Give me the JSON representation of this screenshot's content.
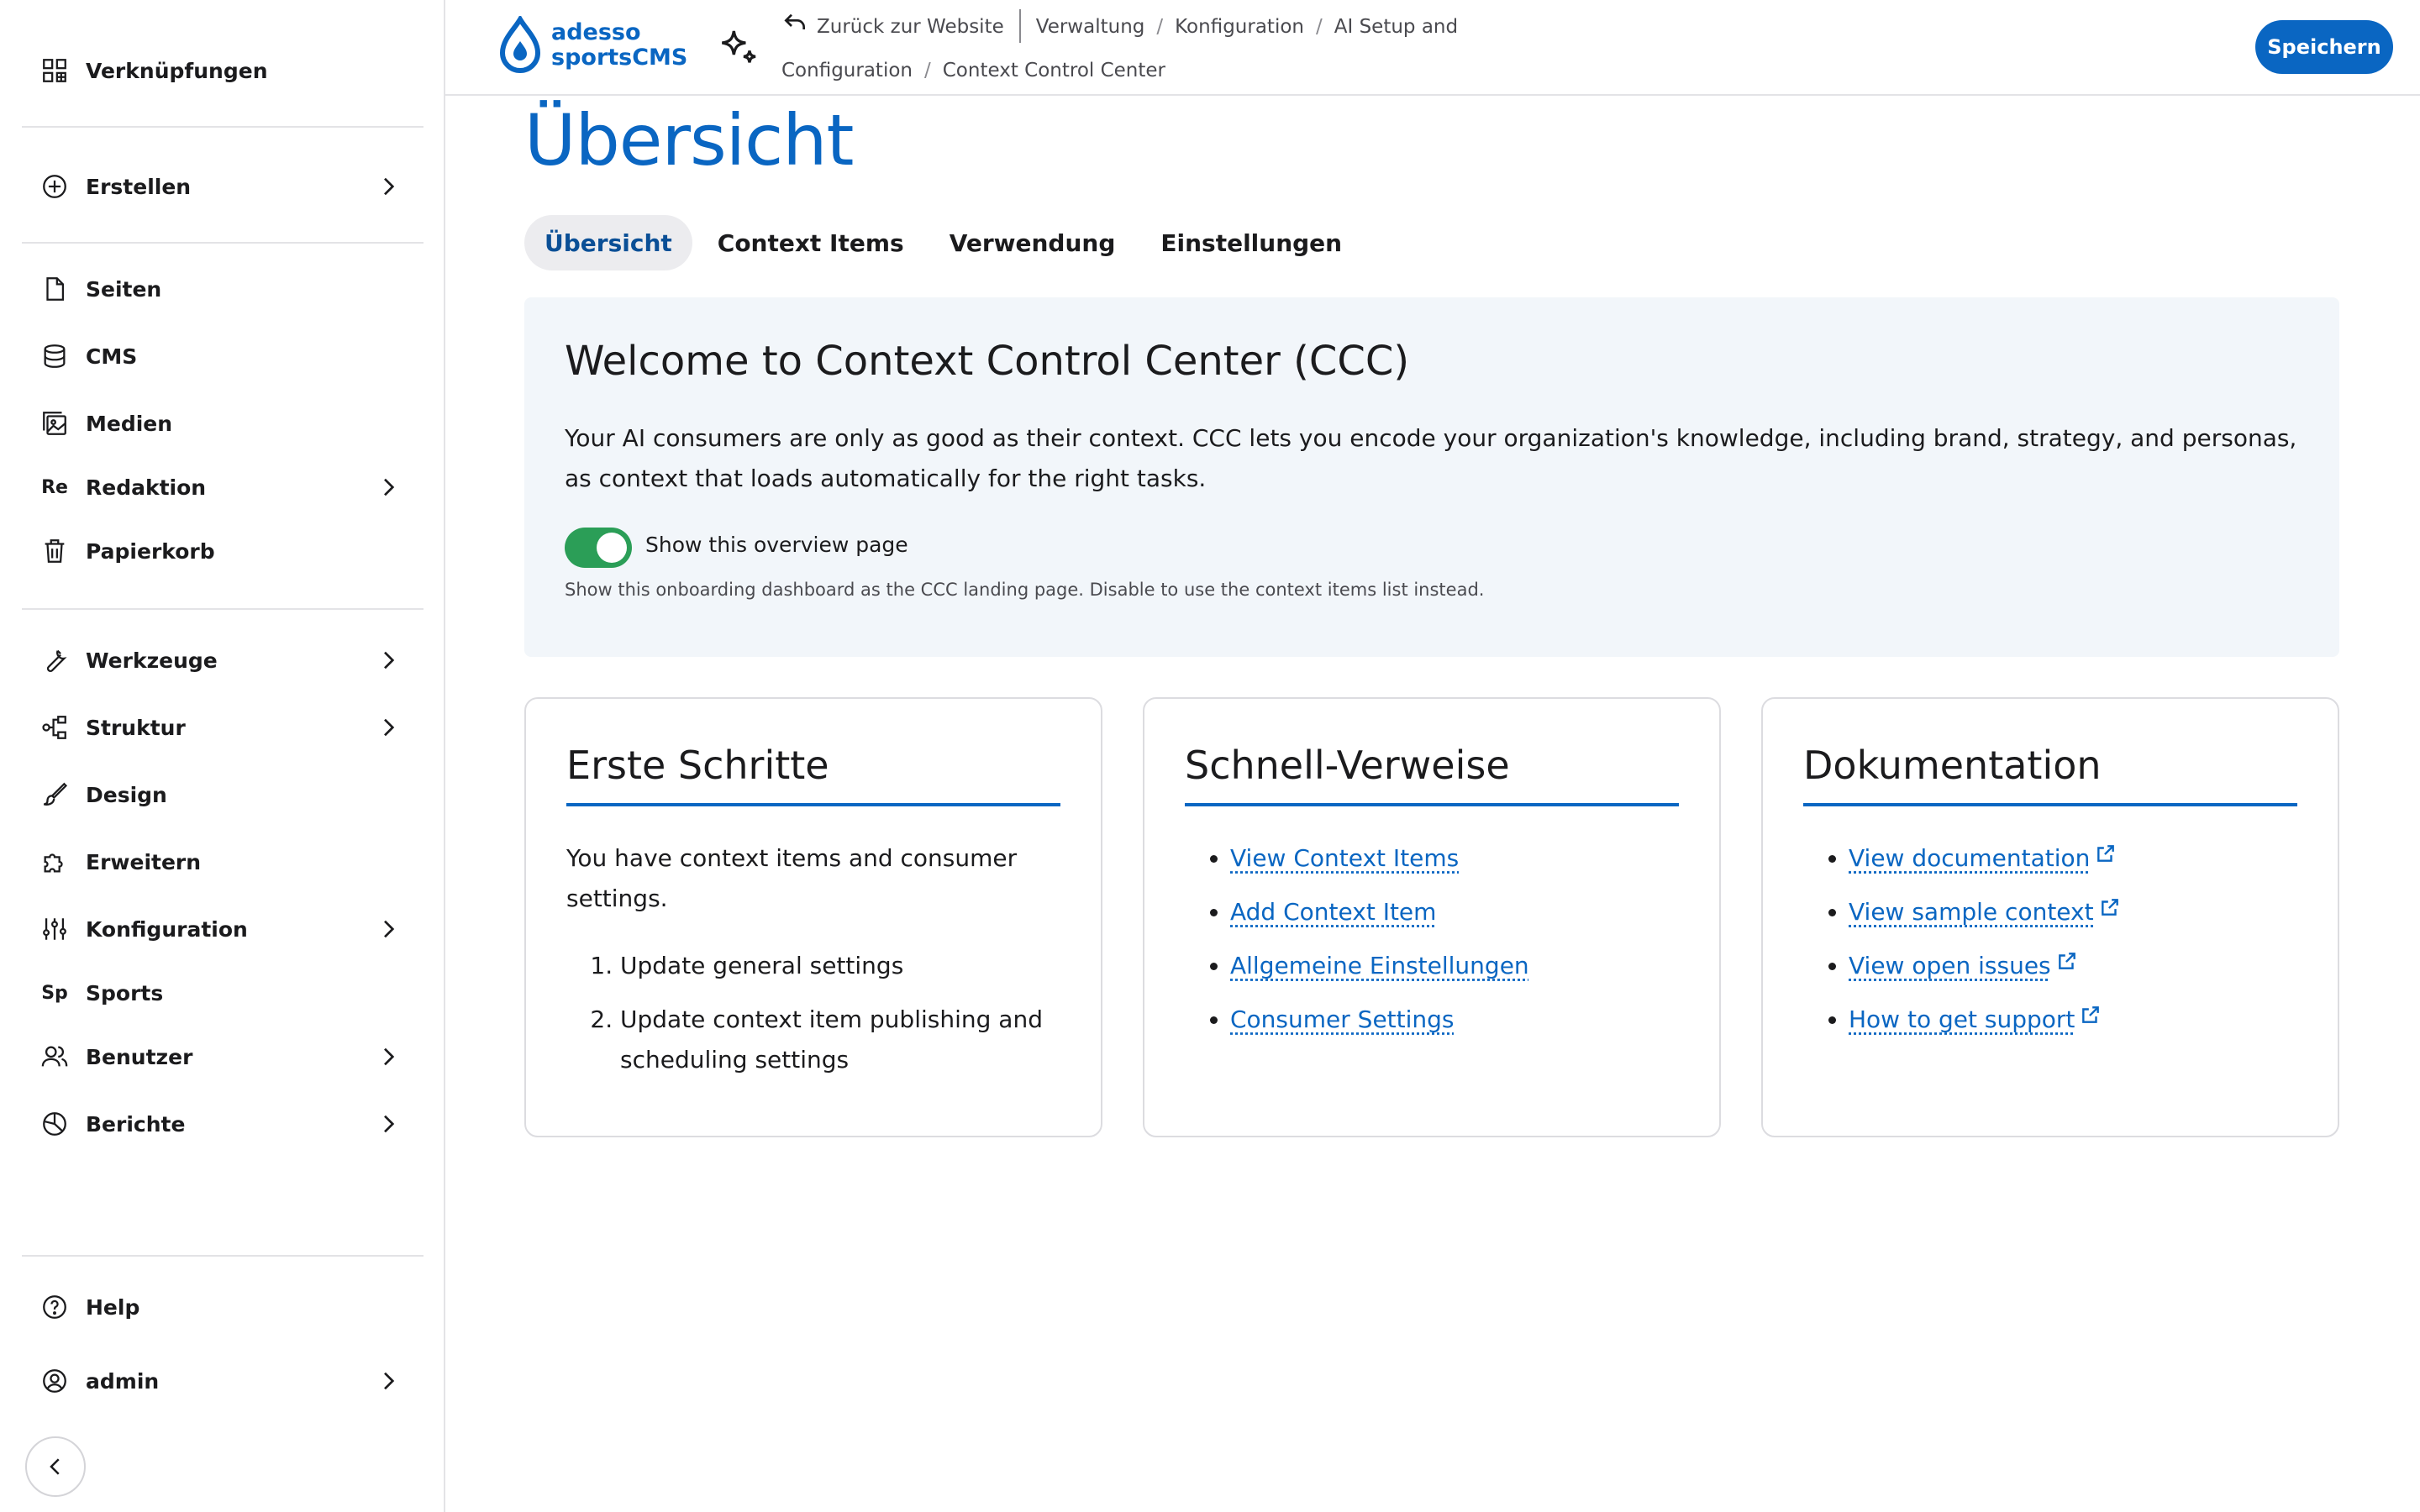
{
  "sidebar": {
    "items": [
      {
        "label": "Verknüpfungen",
        "icon": "shortcuts-icon",
        "expandable": false
      },
      {
        "label": "Erstellen",
        "icon": "plus-circle-icon",
        "expandable": true
      },
      {
        "label": "Seiten",
        "icon": "page-icon",
        "expandable": false
      },
      {
        "label": "CMS",
        "icon": "database-icon",
        "expandable": false
      },
      {
        "label": "Medien",
        "icon": "media-icon",
        "expandable": false
      },
      {
        "label": "Redaktion",
        "abbr": "Re",
        "expandable": true
      },
      {
        "label": "Papierkorb",
        "icon": "trash-icon",
        "expandable": false
      },
      {
        "label": "Werkzeuge",
        "icon": "wrench-icon",
        "expandable": true
      },
      {
        "label": "Struktur",
        "icon": "structure-icon",
        "expandable": true
      },
      {
        "label": "Design",
        "icon": "brush-icon",
        "expandable": false
      },
      {
        "label": "Erweitern",
        "icon": "puzzle-icon",
        "expandable": false
      },
      {
        "label": "Konfiguration",
        "icon": "sliders-icon",
        "expandable": true
      },
      {
        "label": "Sports",
        "abbr": "Sp",
        "expandable": false
      },
      {
        "label": "Benutzer",
        "icon": "users-icon",
        "expandable": true
      },
      {
        "label": "Berichte",
        "icon": "chart-icon",
        "expandable": true
      }
    ],
    "help": "Help",
    "user": "admin"
  },
  "topbar": {
    "logo_line1": "adesso",
    "logo_line2": "sportsCMS",
    "back_link": "Zurück zur Website",
    "crumbs": [
      "Verwaltung",
      "Konfiguration",
      "AI Setup and Configuration",
      "Context Control Center"
    ],
    "save_label": "Speichern"
  },
  "main": {
    "title": "Übersicht",
    "tabs": [
      "Übersicht",
      "Context Items",
      "Verwendung",
      "Einstellungen"
    ],
    "active_tab": 0,
    "welcome": {
      "heading": "Welcome to Context Control Center (CCC)",
      "text": "Your AI consumers are only as good as their context. CCC lets you encode your organization's knowledge, including brand, strategy, and personas, as context that loads automatically for the right tasks.",
      "toggle_label": "Show this overview page",
      "toggle_on": true,
      "toggle_desc": "Show this onboarding dashboard as the CCC landing page. Disable to use the context items list instead."
    },
    "cards": {
      "first_steps": {
        "title": "Erste Schritte",
        "text": "You have context items and consumer settings.",
        "steps": [
          "Update general settings",
          "Update context item publishing and scheduling settings"
        ]
      },
      "quick_links": {
        "title": "Schnell-Verweise",
        "links": [
          "View Context Items",
          "Add Context Item",
          "Allgemeine Einstellungen",
          "Consumer Settings"
        ]
      },
      "docs": {
        "title": "Dokumentation",
        "links": [
          "View documentation",
          "View sample context",
          "View open issues",
          "How to get support"
        ]
      }
    }
  },
  "colors": {
    "accent": "#0a66c2",
    "toggle_on": "#2b9e57",
    "welcome_bg": "#f2f6fa"
  }
}
